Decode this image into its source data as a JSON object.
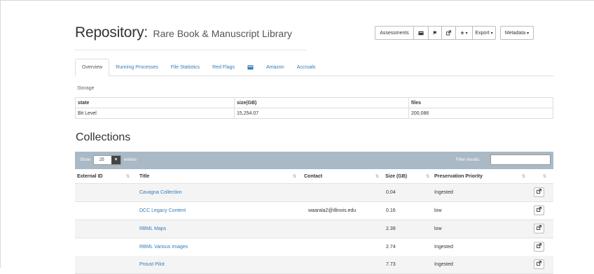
{
  "page": {
    "title": "Repository:",
    "subtitle": "Rare Book & Manuscript Library"
  },
  "toolbar": {
    "assessments_label": "Assessments",
    "export_label": "Export",
    "metadata_label": "Metadata",
    "plus_label": "+",
    "caret": "▾",
    "icons": [
      "card-icon",
      "flag-icon",
      "external-link-icon",
      "plus-icon"
    ]
  },
  "tabs": [
    {
      "label": "Overview",
      "active": true
    },
    {
      "label": "Running Processes"
    },
    {
      "label": "File Statistics"
    },
    {
      "label": "Red Flags"
    },
    {
      "label": "",
      "icon": "card-icon"
    },
    {
      "label": "Amazon"
    },
    {
      "label": "Accruals"
    }
  ],
  "storage": {
    "label": "Storage",
    "headers": [
      "state",
      "size(GB)",
      "files"
    ],
    "row": [
      "Bit Level",
      "15,254.07",
      "200,086"
    ]
  },
  "collections": {
    "heading": "Collections",
    "show_label": "Show",
    "page_length": "25",
    "entries_label": "entries",
    "filter_label": "Filter results:",
    "headers": [
      "External ID",
      "Title",
      "Contact",
      "Size (GB)",
      "Preservation Priority"
    ],
    "rows": [
      {
        "external_id": "",
        "title": "Cavagna Collection",
        "contact": "",
        "size": "0.04",
        "priority": "Ingested"
      },
      {
        "external_id": "",
        "title": "DCC Legacy Content",
        "contact": "waarala2@illinois.edu",
        "size": "0.16",
        "priority": "low"
      },
      {
        "external_id": "",
        "title": "RBML Maps",
        "contact": "",
        "size": "2.39",
        "priority": "low"
      },
      {
        "external_id": "",
        "title": "RBML Various Images",
        "contact": "",
        "size": "2.74",
        "priority": "Ingested"
      },
      {
        "external_id": "",
        "title": "Proust Pilot",
        "contact": "",
        "size": "7.73",
        "priority": "Ingested"
      }
    ]
  },
  "colors": {
    "link": "#337ab7",
    "table_bar": "#a9b9c6"
  }
}
